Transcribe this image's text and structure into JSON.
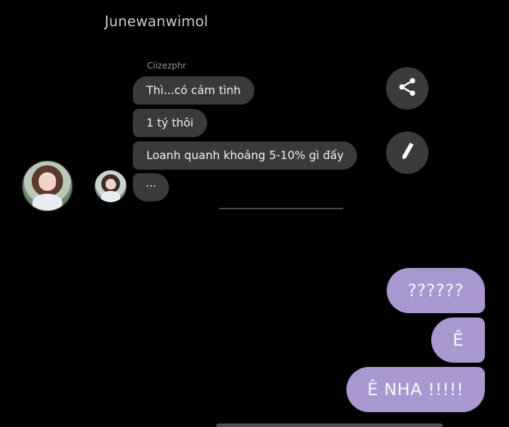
{
  "header": {
    "contact_name": "Junewanwimol"
  },
  "thread": {
    "incoming": {
      "sender_name": "Ciizezphr",
      "messages": [
        "Thì...có cảm tình",
        "1 tý thôi",
        "Loanh quanh khoảng 5-10% gì đấy",
        "..."
      ]
    },
    "outgoing": {
      "messages": [
        "??????",
        "Ê",
        "Ê NHA !!!!!"
      ]
    }
  },
  "actions": {
    "share_icon": "share-icon",
    "edit_icon": "pencil-icon"
  },
  "colors": {
    "background": "#000000",
    "incoming_bubble": "#3a3a3a",
    "outgoing_bubble": "#a997cf",
    "fab_background": "#3b3b3b"
  }
}
